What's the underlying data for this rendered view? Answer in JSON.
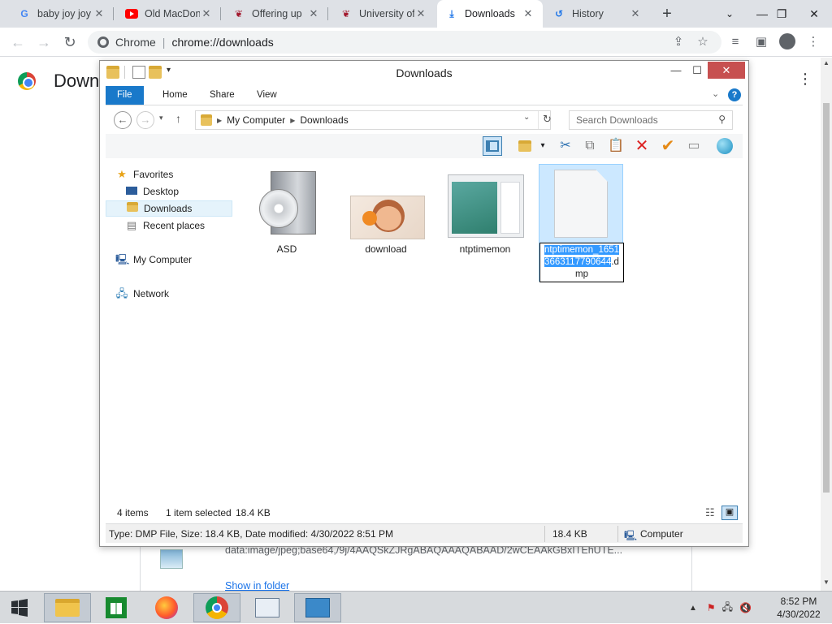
{
  "browser": {
    "tabs": [
      {
        "title": "baby joy joy",
        "icon": "google-icon",
        "active": false
      },
      {
        "title": "Old MacDon",
        "icon": "youtube-icon",
        "active": false
      },
      {
        "title": "Offering up",
        "icon": "university-logo-icon",
        "active": false
      },
      {
        "title": "University of",
        "icon": "university-logo-icon",
        "active": false
      },
      {
        "title": "Downloads",
        "icon": "download-icon",
        "active": true
      },
      {
        "title": "History",
        "icon": "history-icon",
        "active": false
      }
    ],
    "omnibox": {
      "site_label": "Chrome",
      "url": "chrome://downloads"
    }
  },
  "downloads_page": {
    "heading": "Down",
    "item_url": "data:image/jpeg;base64,/9j/4AAQSkZJRgABAQAAAQABAAD/2wCEAAkGBxITEhUTE...",
    "show_in_folder": "Show in folder"
  },
  "explorer": {
    "title": "Downloads",
    "ribbon_tabs": [
      "File",
      "Home",
      "Share",
      "View"
    ],
    "breadcrumb": [
      "My Computer",
      "Downloads"
    ],
    "search_placeholder": "Search Downloads",
    "nav": {
      "favorites": "Favorites",
      "desktop": "Desktop",
      "downloads": "Downloads",
      "recent": "Recent places",
      "computer": "My Computer",
      "network": "Network"
    },
    "files": [
      {
        "name": "ASD",
        "icon": "installer-box-icon"
      },
      {
        "name": "download",
        "icon": "image-thumbnail-icon"
      },
      {
        "name": "ntptimemon",
        "icon": "app-window-icon"
      }
    ],
    "renaming_file": {
      "selected_text": "ntptimemon_1651366311779064​4",
      "selected_part": "ntptimemon_16513663117790644",
      "extension_part": ".dmp",
      "icon": "blank-file-icon"
    },
    "status": {
      "count": "4 items",
      "selected": "1 item selected",
      "size": "18.4 KB"
    },
    "details": {
      "info": "Type: DMP File, Size: 18.4 KB, Date modified: 4/30/2022 8:51 PM",
      "size": "18.4 KB",
      "location": "Computer"
    }
  },
  "taskbar": {
    "apps": [
      "start-icon",
      "file-explorer-icon",
      "store-icon",
      "firefox-icon",
      "chrome-icon",
      "task-manager-icon",
      "control-panel-icon"
    ],
    "time": "8:52 PM",
    "date": "4/30/2022"
  }
}
